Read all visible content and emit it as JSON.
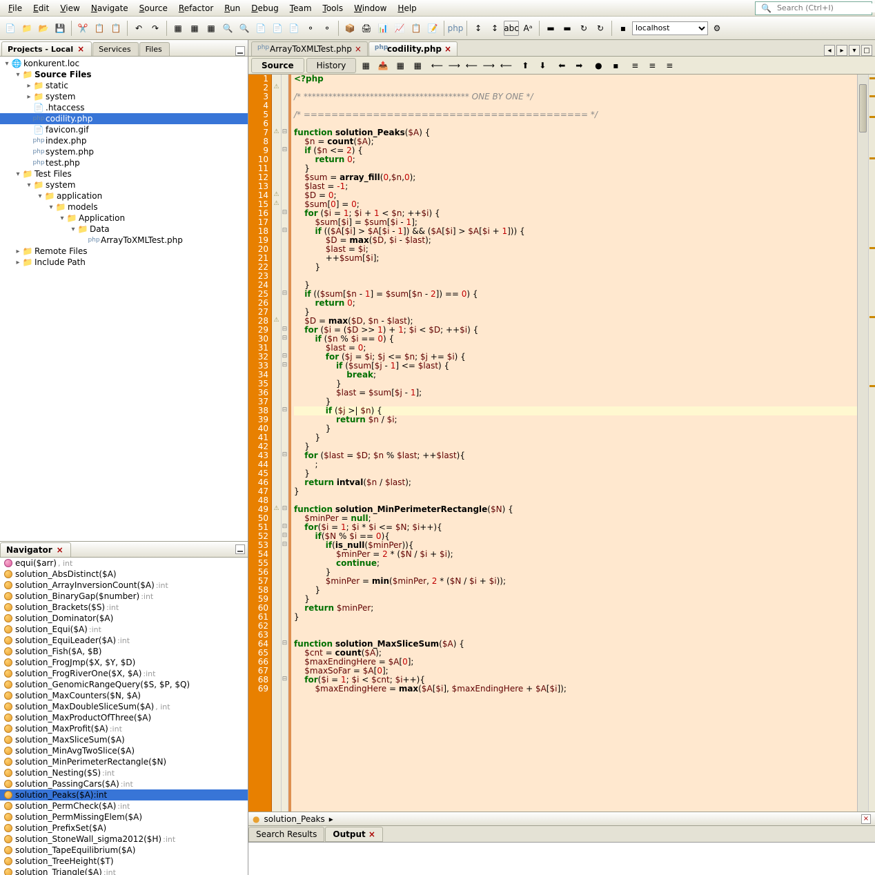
{
  "menu": [
    "File",
    "Edit",
    "View",
    "Navigate",
    "Source",
    "Refactor",
    "Run",
    "Debug",
    "Team",
    "Tools",
    "Window",
    "Help"
  ],
  "search_placeholder": "Search (Ctrl+I)",
  "host": "localhost",
  "left_tabs": [
    {
      "label": "Projects - Local",
      "close": true,
      "active": true
    },
    {
      "label": "Services",
      "close": false,
      "active": false
    },
    {
      "label": "Files",
      "close": false,
      "active": false
    }
  ],
  "tree": [
    {
      "d": 0,
      "tw": "▾",
      "ic": "earth",
      "t": "konkurent.loc"
    },
    {
      "d": 1,
      "tw": "▾",
      "ic": "folder",
      "t": "Source Files",
      "bold": true
    },
    {
      "d": 2,
      "tw": "▸",
      "ic": "folder",
      "t": "static"
    },
    {
      "d": 2,
      "tw": "▸",
      "ic": "folder",
      "t": "system"
    },
    {
      "d": 2,
      "tw": "",
      "ic": "file",
      "t": ".htaccess"
    },
    {
      "d": 2,
      "tw": "",
      "ic": "php",
      "t": "codility.php",
      "sel": true
    },
    {
      "d": 2,
      "tw": "",
      "ic": "file",
      "t": "favicon.gif"
    },
    {
      "d": 2,
      "tw": "",
      "ic": "php",
      "t": "index.php"
    },
    {
      "d": 2,
      "tw": "",
      "ic": "php",
      "t": "system.php"
    },
    {
      "d": 2,
      "tw": "",
      "ic": "php",
      "t": "test.php"
    },
    {
      "d": 1,
      "tw": "▾",
      "ic": "folder",
      "t": "Test Files"
    },
    {
      "d": 2,
      "tw": "▾",
      "ic": "folder",
      "t": "system"
    },
    {
      "d": 3,
      "tw": "▾",
      "ic": "folder",
      "t": "application"
    },
    {
      "d": 4,
      "tw": "▾",
      "ic": "folder",
      "t": "models"
    },
    {
      "d": 5,
      "tw": "▾",
      "ic": "folder",
      "t": "Application"
    },
    {
      "d": 6,
      "tw": "▾",
      "ic": "folder",
      "t": "Data"
    },
    {
      "d": 7,
      "tw": "",
      "ic": "php",
      "t": "ArrayToXMLTest.php"
    },
    {
      "d": 1,
      "tw": "▸",
      "ic": "folder",
      "t": "Remote Files"
    },
    {
      "d": 1,
      "tw": "▸",
      "ic": "folder",
      "t": "Include Path"
    }
  ],
  "nav_title": "Navigator",
  "nav": [
    {
      "sig": "equi($arr)",
      "typ": ", int",
      "pink": true
    },
    {
      "sig": "solution_AbsDistinct($A)"
    },
    {
      "sig": "solution_ArrayInversionCount($A)",
      "typ": ":int"
    },
    {
      "sig": "solution_BinaryGap($number)",
      "typ": ":int"
    },
    {
      "sig": "solution_Brackets($S)",
      "typ": ":int"
    },
    {
      "sig": "solution_Dominator($A)"
    },
    {
      "sig": "solution_Equi($A)",
      "typ": ":int"
    },
    {
      "sig": "solution_EquiLeader($A)",
      "typ": ":int"
    },
    {
      "sig": "solution_Fish($A, $B)"
    },
    {
      "sig": "solution_FrogJmp($X, $Y, $D)"
    },
    {
      "sig": "solution_FrogRiverOne($X, $A)",
      "typ": ":int"
    },
    {
      "sig": "solution_GenomicRangeQuery($S, $P, $Q)"
    },
    {
      "sig": "solution_MaxCounters($N, $A)"
    },
    {
      "sig": "solution_MaxDoubleSliceSum($A)",
      "typ": ", int"
    },
    {
      "sig": "solution_MaxProductOfThree($A)"
    },
    {
      "sig": "solution_MaxProfit($A)",
      "typ": ":int"
    },
    {
      "sig": "solution_MaxSliceSum($A)"
    },
    {
      "sig": "solution_MinAvgTwoSlice($A)"
    },
    {
      "sig": "solution_MinPerimeterRectangle($N)"
    },
    {
      "sig": "solution_Nesting($S)",
      "typ": ":int"
    },
    {
      "sig": "solution_PassingCars($A)",
      "typ": ":int"
    },
    {
      "sig": "solution_Peaks($A):int",
      "sel": true
    },
    {
      "sig": "solution_PermCheck($A)",
      "typ": ":int"
    },
    {
      "sig": "solution_PermMissingElem($A)"
    },
    {
      "sig": "solution_PrefixSet($A)"
    },
    {
      "sig": "solution_StoneWall_sigma2012($H)",
      "typ": ":int"
    },
    {
      "sig": "solution_TapeEquilibrium($A)"
    },
    {
      "sig": "solution_TreeHeight($T)"
    },
    {
      "sig": "solution_Triangle($A)",
      "typ": ":int"
    }
  ],
  "editor_tabs": [
    {
      "label": "ArrayToXMLTest.php",
      "close": true,
      "active": false
    },
    {
      "label": "codility.php",
      "close": true,
      "active": true
    }
  ],
  "src_tabs": [
    {
      "label": "Source",
      "active": true
    },
    {
      "label": "History",
      "active": false
    }
  ],
  "crumb": {
    "icon": "●",
    "text": "solution_Peaks",
    "arrow": "▸"
  },
  "bottom_tabs": [
    {
      "label": "Search Results",
      "active": false
    },
    {
      "label": "Output",
      "close": true,
      "active": true
    }
  ],
  "lines_start": 1,
  "lines_end": 69,
  "code": [
    {
      "t": "<?php",
      "cl": "kw"
    },
    {
      "t": ""
    },
    {
      "t": "/* **************************************** ONE BY ONE */",
      "cl": "cm"
    },
    {
      "t": ""
    },
    {
      "t": "/* ========================================= */",
      "cl": "cm"
    },
    {
      "t": ""
    },
    {
      "raw": "<span class='kw'>function</span> <span class='fn'>solution_Peaks</span>(<span class='var'>$A</span>) {"
    },
    {
      "raw": "    <span class='var'>$n</span> = <span class='fn'>count</span>(<span class='var'>$A</span>);"
    },
    {
      "raw": "    <span class='kw'>if</span> (<span class='var'>$n</span> <= <span class='num'>2</span>) {"
    },
    {
      "raw": "        <span class='kw'>return</span> <span class='num'>0</span>;"
    },
    {
      "raw": "    }"
    },
    {
      "raw": "    <span class='var'>$sum</span> = <span class='fn'>array_fill</span>(<span class='num'>0</span>,<span class='var'>$n</span>,<span class='num'>0</span>);"
    },
    {
      "raw": "    <span class='var'>$last</span> = <span class='num'>-1</span>;"
    },
    {
      "raw": "    <span class='var'>$D</span> = <span class='num'>0</span>;"
    },
    {
      "raw": "    <span class='var'>$sum</span>[<span class='num'>0</span>] = <span class='num'>0</span>;"
    },
    {
      "raw": "    <span class='kw'>for</span> (<span class='var'>$i</span> = <span class='num'>1</span>; <span class='var'>$i</span> + <span class='num'>1</span> < <span class='var'>$n</span>; ++<span class='var'>$i</span>) {"
    },
    {
      "raw": "        <span class='var'>$sum</span>[<span class='var'>$i</span>] = <span class='var'>$sum</span>[<span class='var'>$i</span> - <span class='num'>1</span>];"
    },
    {
      "raw": "        <span class='kw'>if</span> ((<span class='var'>$A</span>[<span class='var'>$i</span>] > <span class='var'>$A</span>[<span class='var'>$i</span> - <span class='num'>1</span>]) && (<span class='var'>$A</span>[<span class='var'>$i</span>] > <span class='var'>$A</span>[<span class='var'>$i</span> + <span class='num'>1</span>])) {"
    },
    {
      "raw": "            <span class='var'>$D</span> = <span class='fn'>max</span>(<span class='var'>$D</span>, <span class='var'>$i</span> - <span class='var'>$last</span>);"
    },
    {
      "raw": "            <span class='var'>$last</span> = <span class='var'>$i</span>;"
    },
    {
      "raw": "            ++<span class='var'>$sum</span>[<span class='var'>$i</span>];"
    },
    {
      "raw": "        }"
    },
    {
      "raw": ""
    },
    {
      "raw": "    }"
    },
    {
      "raw": "    <span class='kw'>if</span> ((<span class='var'>$sum</span>[<span class='var'>$n</span> - <span class='num'>1</span>] = <span class='var'>$sum</span>[<span class='var'>$n</span> - <span class='num'>2</span>]) == <span class='num'>0</span>) {"
    },
    {
      "raw": "        <span class='kw'>return</span> <span class='num'>0</span>;"
    },
    {
      "raw": "    }"
    },
    {
      "raw": "    <span class='var'>$D</span> = <span class='fn'>max</span>(<span class='var'>$D</span>, <span class='var'>$n</span> - <span class='var'>$last</span>);"
    },
    {
      "raw": "    <span class='kw'>for</span> (<span class='var'>$i</span> = (<span class='var'>$D</span> >> <span class='num'>1</span>) + <span class='num'>1</span>; <span class='var'>$i</span> < <span class='var'>$D</span>; ++<span class='var'>$i</span>) {"
    },
    {
      "raw": "        <span class='kw'>if</span> (<span class='var'>$n</span> % <span class='var'>$i</span> == <span class='num'>0</span>) {"
    },
    {
      "raw": "            <span class='var'>$last</span> = <span class='num'>0</span>;"
    },
    {
      "raw": "            <span class='kw'>for</span> (<span class='var'>$j</span> = <span class='var'>$i</span>; <span class='var'>$j</span> <= <span class='var'>$n</span>; <span class='var'>$j</span> += <span class='var'>$i</span>) {"
    },
    {
      "raw": "                <span class='kw'>if</span> (<span class='var'>$sum</span>[<span class='var'>$j</span> - <span class='num'>1</span>] <= <span class='var'>$last</span>) {"
    },
    {
      "raw": "                    <span class='kw'>break</span>;"
    },
    {
      "raw": "                }"
    },
    {
      "raw": "                <span class='var'>$last</span> = <span class='var'>$sum</span>[<span class='var'>$j</span> - <span class='num'>1</span>];"
    },
    {
      "raw": "            }"
    },
    {
      "raw": "            <span class='kw'>if</span> (<span class='var'>$j</span> >| <span class='var'>$n</span>) {",
      "hl": true
    },
    {
      "raw": "                <span class='kw'>return</span> <span class='var'>$n</span> / <span class='var'>$i</span>;"
    },
    {
      "raw": "            }"
    },
    {
      "raw": "        }"
    },
    {
      "raw": "    }"
    },
    {
      "raw": "    <span class='kw'>for</span> (<span class='var'>$last</span> = <span class='var'>$D</span>; <span class='var'>$n</span> % <span class='var'>$last</span>; ++<span class='var'>$last</span>){"
    },
    {
      "raw": "        ;"
    },
    {
      "raw": "    }"
    },
    {
      "raw": "    <span class='kw'>return</span> <span class='fn'>intval</span>(<span class='var'>$n</span> / <span class='var'>$last</span>);"
    },
    {
      "raw": "}"
    },
    {
      "raw": ""
    },
    {
      "raw": "<span class='kw'>function</span> <span class='fn'>solution_MinPerimeterRectangle</span>(<span class='var'>$N</span>) {"
    },
    {
      "raw": "    <span class='var'>$minPer</span> = <span class='kw'>null</span>;"
    },
    {
      "raw": "    <span class='kw'>for</span>(<span class='var'>$i</span> = <span class='num'>1</span>; <span class='var'>$i</span> * <span class='var'>$i</span> <= <span class='var'>$N</span>; <span class='var'>$i</span>++){"
    },
    {
      "raw": "        <span class='kw'>if</span>(<span class='var'>$N</span> % <span class='var'>$i</span> == <span class='num'>0</span>){"
    },
    {
      "raw": "            <span class='kw'>if</span>(<span class='fn'>is_null</span>(<span class='var'>$minPer</span>)){"
    },
    {
      "raw": "                <span class='var'>$minPer</span> = <span class='num'>2</span> * (<span class='var'>$N</span> / <span class='var'>$i</span> + <span class='var'>$i</span>);"
    },
    {
      "raw": "                <span class='kw'>continue</span>;"
    },
    {
      "raw": "            }"
    },
    {
      "raw": "            <span class='var'>$minPer</span> = <span class='fn'>min</span>(<span class='var'>$minPer</span>, <span class='num'>2</span> * (<span class='var'>$N</span> / <span class='var'>$i</span> + <span class='var'>$i</span>));"
    },
    {
      "raw": "        }"
    },
    {
      "raw": "    }"
    },
    {
      "raw": "    <span class='kw'>return</span> <span class='var'>$minPer</span>;"
    },
    {
      "raw": "}"
    },
    {
      "raw": ""
    },
    {
      "raw": ""
    },
    {
      "raw": "<span class='kw'>function</span> <span class='fn'>solution_MaxSliceSum</span>(<span class='var'>$A</span>) {"
    },
    {
      "raw": "    <span class='var'>$cnt</span> = <span class='fn'>count</span>(<span class='var'>$A</span>);"
    },
    {
      "raw": "    <span class='var'>$maxEndingHere</span> = <span class='var'>$A</span>[<span class='num'>0</span>];"
    },
    {
      "raw": "    <span class='var'>$maxSoFar</span> = <span class='var'>$A</span>[<span class='num'>0</span>];"
    },
    {
      "raw": "    <span class='kw'>for</span>(<span class='var'>$i</span> = <span class='num'>1</span>; <span class='var'>$i</span> < <span class='var'>$cnt</span>; <span class='var'>$i</span>++){"
    },
    {
      "raw": "        <span class='var'>$maxEndingHere</span> = <span class='fn'>max</span>(<span class='var'>$A</span>[<span class='var'>$i</span>], <span class='var'>$maxEndingHere</span> + <span class='var'>$A</span>[<span class='var'>$i</span>]);"
    }
  ]
}
